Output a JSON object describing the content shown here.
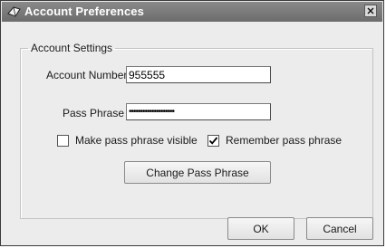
{
  "window": {
    "title": "Account Preferences",
    "title_icon": "app-icon",
    "close_label": "x"
  },
  "group": {
    "legend": "Account Settings"
  },
  "fields": {
    "account_number": {
      "label": "Account Number",
      "value": "955555"
    },
    "pass_phrase": {
      "label": "Pass Phrase",
      "value": "••••••••••••••••••••"
    }
  },
  "checkboxes": {
    "make_visible": {
      "label": "Make pass phrase visible",
      "checked": false
    },
    "remember": {
      "label": "Remember pass phrase",
      "checked": true
    }
  },
  "buttons": {
    "change": "Change Pass Phrase",
    "ok": "OK",
    "cancel": "Cancel"
  },
  "colors": {
    "titlebar": "#7a7a7a",
    "dialog_bg": "#ececec"
  }
}
